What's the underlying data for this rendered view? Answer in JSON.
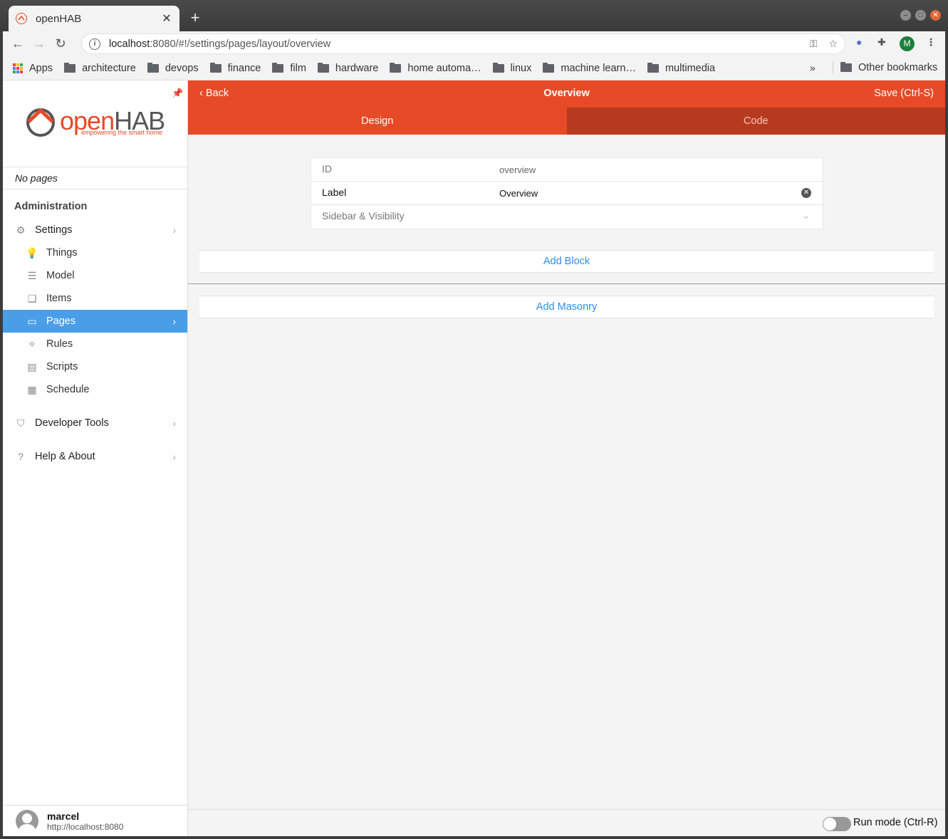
{
  "browser": {
    "tab_title": "openHAB",
    "tab_close": "✕",
    "new_tab": "+",
    "url_host": "localhost",
    "url_path": ":8080/#!/settings/pages/layout/overview",
    "profile_initial": "M",
    "bookmarks": [
      {
        "label": "Apps",
        "type": "apps"
      },
      {
        "label": "architecture",
        "type": "folder"
      },
      {
        "label": "devops",
        "type": "folder"
      },
      {
        "label": "finance",
        "type": "folder"
      },
      {
        "label": "film",
        "type": "folder"
      },
      {
        "label": "hardware",
        "type": "folder"
      },
      {
        "label": "home automa…",
        "type": "folder"
      },
      {
        "label": "linux",
        "type": "folder"
      },
      {
        "label": "machine learn…",
        "type": "folder"
      },
      {
        "label": "multimedia",
        "type": "folder"
      }
    ],
    "more_bookmarks": "»",
    "other_bookmarks": "Other bookmarks"
  },
  "sidebar": {
    "logo_word_prefix": "open",
    "logo_word_suffix": "HAB",
    "logo_tagline": "empowering the smart home",
    "no_pages": "No pages",
    "section_title": "Administration",
    "settings": "Settings",
    "sub_items": [
      "Things",
      "Model",
      "Items",
      "Pages",
      "Rules",
      "Scripts",
      "Schedule"
    ],
    "developer_tools": "Developer Tools",
    "help_about": "Help & About",
    "user_name": "marcel",
    "user_host": "http://localhost:8080"
  },
  "navbar": {
    "back": "Back",
    "title": "Overview",
    "save": "Save (Ctrl-S)"
  },
  "tabs": {
    "design": "Design",
    "code": "Code"
  },
  "form": {
    "id_label": "ID",
    "id_value": "overview",
    "label_label": "Label",
    "label_value": "Overview",
    "sidebar_visibility": "Sidebar & Visibility"
  },
  "actions": {
    "add_block": "Add Block",
    "add_masonry": "Add Masonry"
  },
  "footer": {
    "run_mode": "Run mode (Ctrl-R)"
  },
  "colors": {
    "brand": "#e64a27",
    "active": "#4a9ee8",
    "link": "#2f8ee5"
  }
}
